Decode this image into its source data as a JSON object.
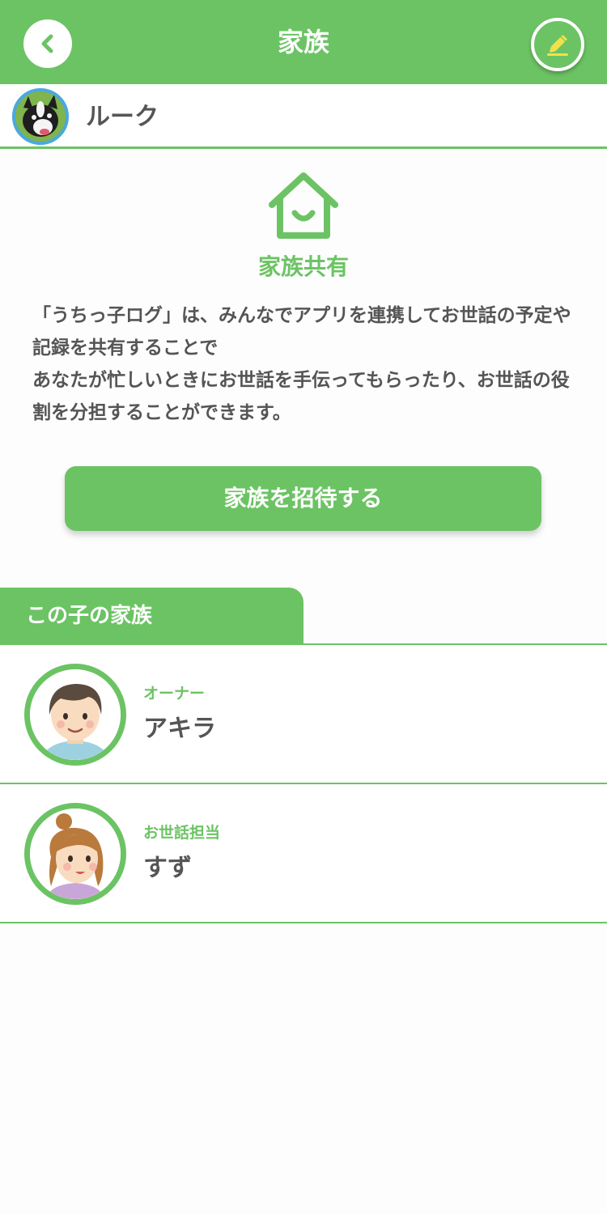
{
  "header": {
    "title": "家族",
    "back_icon": "chevron-left-icon",
    "edit_icon": "pencil-icon"
  },
  "pet": {
    "name": "ルーク"
  },
  "share": {
    "icon": "house-smile-icon",
    "title": "家族共有",
    "description": "「うちっ子ログ」は、みんなでアプリを連携してお世話の予定や記録を共有することで\nあなたが忙しいときにお世話を手伝ってもらったり、お世話の役割を分担することができます。",
    "invite_label": "家族を招待する"
  },
  "family": {
    "tab_label": "この子の家族",
    "members": [
      {
        "role": "オーナー",
        "name": "アキラ"
      },
      {
        "role": "お世話担当",
        "name": "すず"
      }
    ]
  },
  "colors": {
    "accent": "#6cc364",
    "text": "#555555",
    "pencil": "#f2e14a",
    "pet_avatar_border": "#4aa9dd"
  }
}
